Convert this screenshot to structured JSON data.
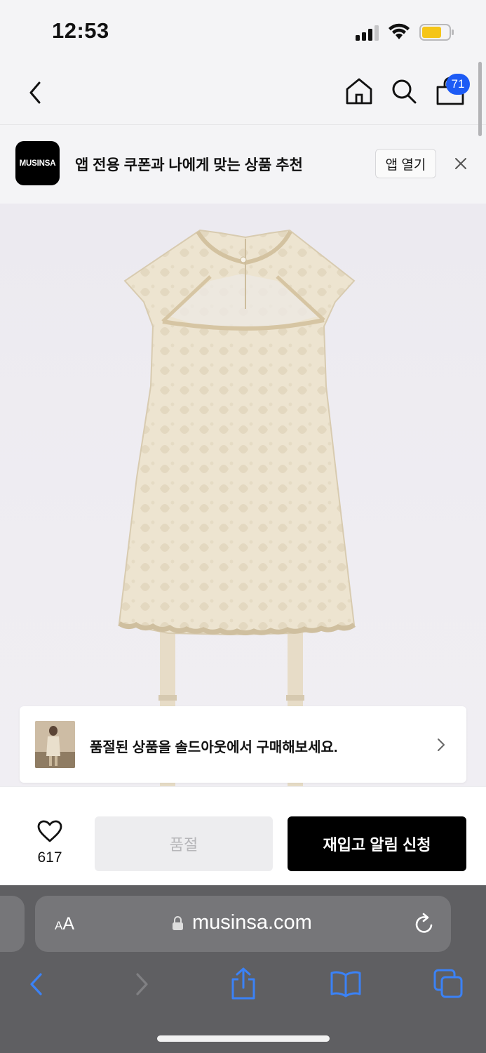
{
  "status_bar": {
    "time": "12:53"
  },
  "header": {
    "cart_badge": "71"
  },
  "app_banner": {
    "logo_text": "MUSINSA",
    "message": "앱 전용 쿠폰과 나에게 맞는 상품 추천",
    "open_app_label": "앱 열기"
  },
  "soldout_card": {
    "message": "품절된 상품을 솔드아웃에서 구매해보세요."
  },
  "action_bar": {
    "like_count": "617",
    "soldout_label": "품절",
    "restock_label": "재입고 알림 신청"
  },
  "browser": {
    "aa_label_small": "A",
    "aa_label_large": "A",
    "url": "musinsa.com"
  },
  "colors": {
    "accent_blue": "#1d5bf5",
    "brand_black": "#000000",
    "safari_link_blue": "#3b82f6"
  },
  "icons": [
    "back-icon",
    "home-icon",
    "search-icon",
    "cart-icon",
    "close-icon",
    "chevron-right-icon",
    "heart-icon",
    "lock-icon",
    "reload-icon",
    "share-icon",
    "bookmarks-icon",
    "tabs-icon"
  ]
}
